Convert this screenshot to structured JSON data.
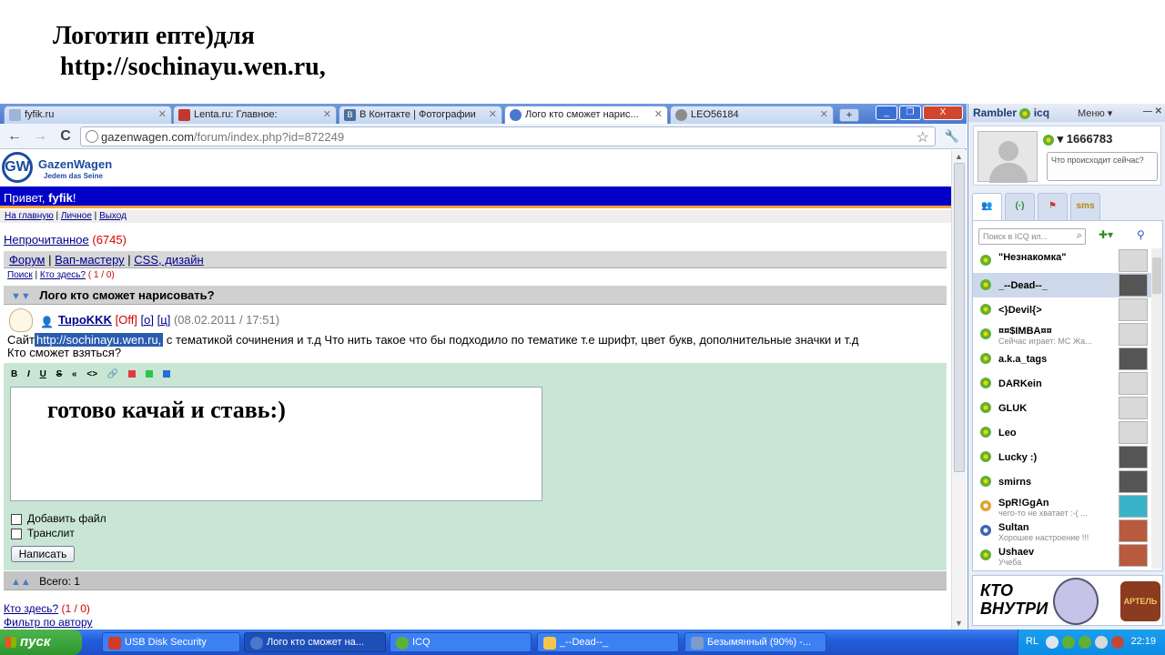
{
  "banner": {
    "line1": "Логотип епте)для",
    "line2": "http://sochinayu.wen.ru,"
  },
  "browser": {
    "tabs": [
      {
        "label": "fyfik.ru",
        "icon_color": "#9db5d8"
      },
      {
        "label": "Lenta.ru: Главное:",
        "icon_color": "#c0392b"
      },
      {
        "label": "В Контакте | Фотографии",
        "icon_color": "#4a6f9c",
        "icon_char": "B"
      },
      {
        "label": "Лого кто сможет нарис...",
        "icon_color": "#4a78cf",
        "active": true
      },
      {
        "label": "LEO56184",
        "icon_color": "#8d8d8d"
      }
    ],
    "new_tab": "+",
    "win_controls": {
      "min": "_",
      "max": "❐",
      "close": "X"
    },
    "url_host": "gazenwagen.com",
    "url_path": "/forum/index.php?id=872249",
    "back": "←",
    "forward": "→",
    "reload": "C",
    "star": "☆",
    "wrench": "🔧"
  },
  "site": {
    "logo_name": "GazenWagen",
    "logo_tag": "Jedem das Seine",
    "logo_mark": "GW",
    "greet_prefix": "Привет, ",
    "greet_user": "fyfik",
    "greet_suffix": "!",
    "toplinks": [
      "На главную",
      "Личное",
      "Выход"
    ],
    "unread_label": "Непрочитанное",
    "unread_count": "(6745)",
    "crumbs": [
      "Форум",
      "Вап-мастеру",
      "CSS, дизайн"
    ],
    "sublinks": {
      "search": "Поиск",
      "who": "Кто здесь?",
      "who_count": "( 1 / 0)"
    },
    "thread_title": "Лого кто сможет нарисовать?",
    "post": {
      "author": "TupoKKK",
      "status": "[Off]",
      "links": [
        "[о]",
        "[ц]"
      ],
      "date": "(08.02.2011 / 17:51)",
      "text_before": "Сайт",
      "text_link": "http://sochinayu.wen.ru,",
      "text_after": "с тематикой сочинения и т.д Что нить такое что бы подходило по тематике т.е шрифт, цвет букв, дополнительные значки и т.д",
      "text_line2": "Кто сможет взяться?"
    },
    "format_buttons": [
      "B",
      "I",
      "U",
      "S",
      "«",
      "<>",
      "🔗"
    ],
    "format_colors": [
      "#e23b3b",
      "#2ec44a",
      "#2a6be0"
    ],
    "reply_text": "готово качай и ставь:)",
    "attach_label": "Добавить файл",
    "translit_label": "Транслит",
    "submit_label": "Написать",
    "total_label": "Всего: 1",
    "who_label": "Кто здесь?",
    "who_count": "(1 / 0)",
    "filter_label": "Фильтр по автору"
  },
  "icq": {
    "title": "Rambler",
    "title2": "icq",
    "menu": "Меню",
    "uin": "1666783",
    "status_placeholder": "Что происходит сейчас?",
    "tabs": [
      "👥",
      "(·)",
      "⚑",
      "sms"
    ],
    "search_placeholder": "Поиск в ICQ ил...",
    "contacts": [
      {
        "name": "\"Незнакомка\"",
        "sub": "",
        "photo": "none"
      },
      {
        "name": "_--Dead--_",
        "sub": "",
        "photo": "dk",
        "selected": true
      },
      {
        "name": "<}Devil{>",
        "sub": "",
        "photo": "none"
      },
      {
        "name": "¤¤$IMBA¤¤",
        "sub": "Сейчас играет: МС Жа...",
        "photo": "gr"
      },
      {
        "name": "a.k.a_tags",
        "sub": "",
        "photo": "dk"
      },
      {
        "name": "DARKein",
        "sub": "",
        "photo": "gr"
      },
      {
        "name": "GLUK",
        "sub": "",
        "photo": "gr"
      },
      {
        "name": "Leo",
        "sub": "",
        "photo": "gr"
      },
      {
        "name": "Lucky :)",
        "sub": "",
        "photo": "dk"
      },
      {
        "name": "smirns",
        "sub": "",
        "photo": "dk"
      },
      {
        "name": "SpR!GgAn",
        "sub": "чего-то не хватает :-( ...",
        "photo": "cy"
      },
      {
        "name": "Sultan",
        "sub": "Хорошее настроение !!!",
        "photo": "rd"
      },
      {
        "name": "Ushaev",
        "sub": "Учеба",
        "photo": "rd"
      }
    ],
    "ad_line1": "КТО",
    "ad_line2": "ВНУТРИ",
    "ad_badge": "АРТЕЛЬ"
  },
  "taskbar": {
    "start": "пуск",
    "items": [
      {
        "label": "USB Disk Security",
        "icon_color": "#d23a2a"
      },
      {
        "label": "Лого кто сможет на...",
        "icon_color": "#4a78cf",
        "active": true
      },
      {
        "label": "ICQ",
        "icon_color": "#5fb135"
      },
      {
        "label": "_--Dead--_",
        "icon_color": "#f3c64b"
      },
      {
        "label": "Безымянный (90%) -...",
        "icon_color": "#7f9bc9"
      }
    ],
    "tray_lang": "RL",
    "clock": "22:19"
  }
}
